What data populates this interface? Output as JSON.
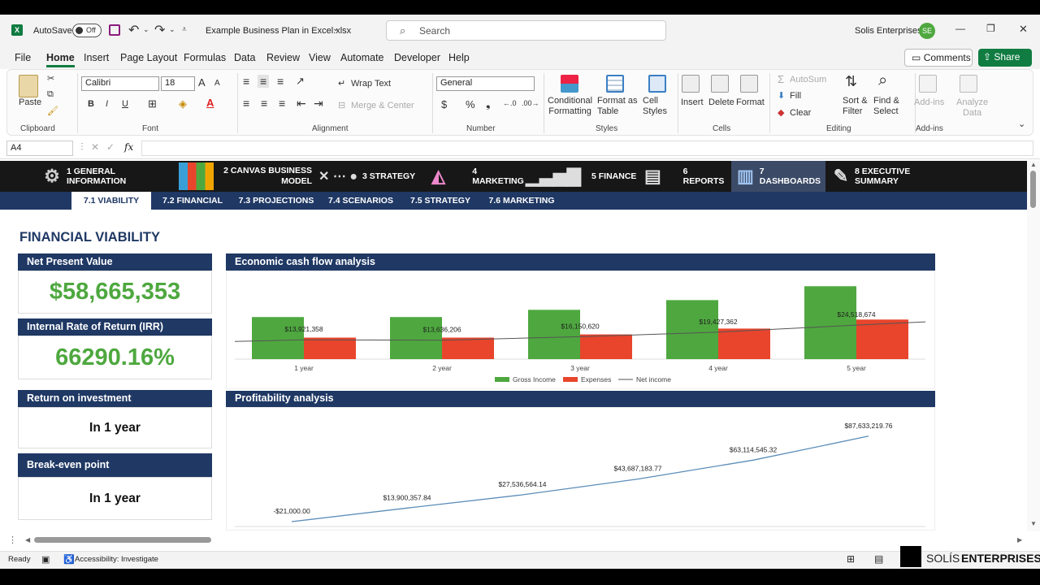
{
  "titlebar": {
    "autosave_label": "AutoSave",
    "autosave_state": "Off",
    "filename": "Example Business Plan in Excel.xlsx",
    "search_placeholder": "Search",
    "org_name": "Solis Enterprises",
    "user_initials": "SE",
    "minimize": "—",
    "restore": "❐",
    "close": "✕"
  },
  "menu": {
    "items": [
      "File",
      "Home",
      "Insert",
      "Page Layout",
      "Formulas",
      "Data",
      "Review",
      "View",
      "Automate",
      "Developer",
      "Help"
    ],
    "active": "Home",
    "comments_label": "Comments",
    "share_label": "Share"
  },
  "ribbon": {
    "clipboard": {
      "paste": "Paste",
      "label": "Clipboard"
    },
    "font": {
      "name": "Calibri",
      "size": "18",
      "label": "Font",
      "bold": "B",
      "italic": "I",
      "underline": "U",
      "grow": "A",
      "shrink": "A"
    },
    "alignment": {
      "wrap": "Wrap Text",
      "merge": "Merge & Center",
      "label": "Alignment"
    },
    "number": {
      "format": "General",
      "currency": "$",
      "percent": "%",
      "comma": "❟",
      "label": "Number"
    },
    "styles": {
      "conditional": [
        "Conditional",
        "Formatting"
      ],
      "format_table": [
        "Format as",
        "Table"
      ],
      "cell_styles": [
        "Cell",
        "Styles"
      ],
      "label": "Styles"
    },
    "cells": {
      "insert": "Insert",
      "delete": "Delete",
      "format": "Format",
      "label": "Cells"
    },
    "editing": {
      "autosum": "AutoSum",
      "fill": "Fill",
      "clear": "Clear",
      "sort": [
        "Sort &",
        "Filter"
      ],
      "find": [
        "Find &",
        "Select"
      ],
      "label": "Editing"
    },
    "addins": {
      "addins": "Add-ins",
      "analyze": [
        "Analyze",
        "Data"
      ],
      "label": "Add-ins"
    }
  },
  "formula_bar": {
    "name_box": "A4",
    "fx": "fx",
    "value": ""
  },
  "nav": {
    "items": [
      {
        "label": "1 GENERAL INFORMATION",
        "icon": "gear-icon"
      },
      {
        "label": "2 CANVAS BUSINESS MODEL",
        "icon": "canvas-icon"
      },
      {
        "label": "3 STRATEGY",
        "icon": "strategy-icon"
      },
      {
        "label": "4 MARKETING",
        "icon": "marketing-icon"
      },
      {
        "label": "5 FINANCE",
        "icon": "finance-icon"
      },
      {
        "label": "6 REPORTS",
        "icon": "reports-icon"
      },
      {
        "label": "7 DASHBOARDS",
        "icon": "dashboard-icon"
      },
      {
        "label": "8 EXECUTIVE SUMMARY",
        "icon": "summary-icon"
      }
    ],
    "active": "7 DASHBOARDS"
  },
  "subnav": {
    "items": [
      "7.1 VIABILITY",
      "7.2 FINANCIAL",
      "7.3 PROJECTIONS",
      "7.4 SCENARIOS",
      "7.5 STRATEGY",
      "7.6 MARKETING"
    ],
    "active": "7.1 VIABILITY"
  },
  "page": {
    "title": "FINANCIAL VIABILITY"
  },
  "cards": {
    "npv": {
      "label": "Net Present Value",
      "value": "$58,665,353"
    },
    "irr": {
      "label": "Internal Rate of Return (IRR)",
      "value": "66290.16%"
    },
    "roi": {
      "label": "Return on investment",
      "value": "In 1 year"
    },
    "breakeven": {
      "label": "Break-even point",
      "value": "In 1 year"
    }
  },
  "chart_data": [
    {
      "type": "bar",
      "title": "Economic cash flow analysis",
      "categories": [
        "1 year",
        "2 year",
        "3 year",
        "4 year",
        "5 year"
      ],
      "series": [
        {
          "name": "Gross Income",
          "values": [
            30300000,
            30300000,
            35500000,
            42500000,
            52500000
          ],
          "color": "#4ea83f"
        },
        {
          "name": "Expenses",
          "values": [
            15500000,
            15500000,
            17800000,
            22000000,
            28500000
          ],
          "color": "#e8452c"
        },
        {
          "name": "Net income",
          "values": [
            13921358,
            13636206,
            16150620,
            19427362,
            24518674
          ],
          "color": "#555555"
        }
      ],
      "data_labels": [
        "$13,921,358",
        "$13,636,206",
        "$16,150,620",
        "$19,427,362",
        "$24,518,674"
      ],
      "legend": "bottom",
      "ylim": [
        0,
        55000000
      ]
    },
    {
      "type": "line",
      "title": "Profitability analysis",
      "series": [
        {
          "name": "Profitability",
          "values": [
            -21000,
            13900357.84,
            27536564.14,
            43687183.77,
            63114545.32,
            87633219.76
          ],
          "color": "#5b8db8"
        }
      ],
      "data_labels": [
        "-$21,000.00",
        "$13,900,357.84",
        "$27,536,564.14",
        "$43,687,183.77",
        "$63,114,545.32",
        "$87,633,219.76"
      ],
      "ylim": [
        -5000000,
        95000000
      ]
    }
  ],
  "status": {
    "ready": "Ready",
    "accessibility": "Accessibility: Investigate",
    "brand_left": "SOLÍS",
    "brand_right": "ENTERPRISES"
  }
}
